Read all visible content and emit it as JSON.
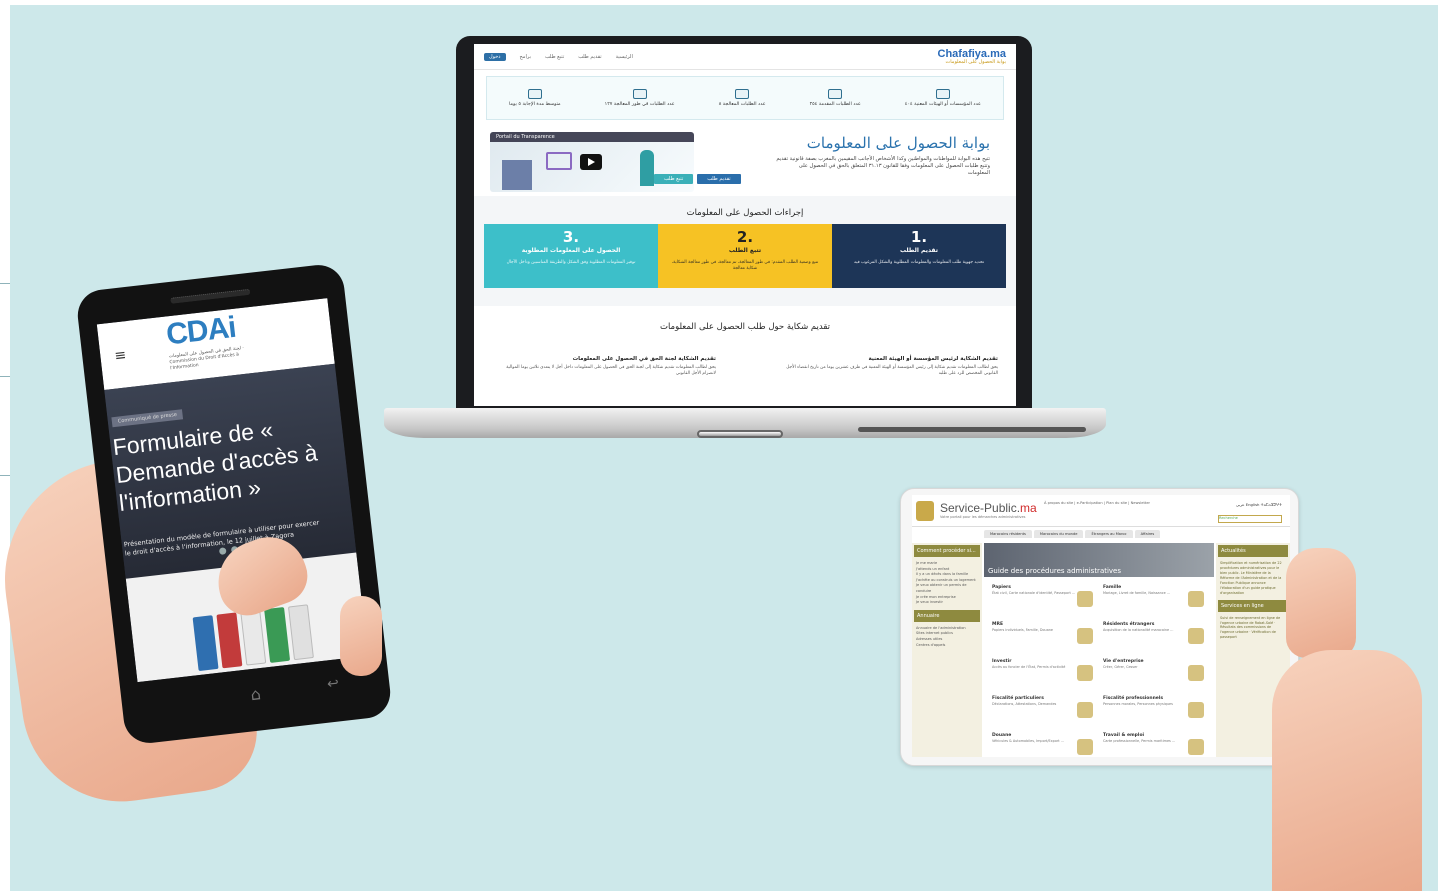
{
  "laptop": {
    "logo": "Chafafiya.ma",
    "logo_subtitle": "بوابة الحصول على المعلومات",
    "nav": [
      "الرئيسية",
      "تقديم طلب",
      "تتبع طلب",
      "برامج"
    ],
    "nav_button": "دخول",
    "stats": [
      "عدد المؤسسات أو الهيئات المعنية ٤٠٤",
      "عدد الطلبات المقدمة ٢٥٤",
      "عدد الطلبات المعالجة ٨",
      "عدد الطلبات في طور المعالجة ١٢٧",
      "متوسط مدة الإجابة ٥ يوما"
    ],
    "hero_title": "بوابة الحصول على المعلومات",
    "hero_desc": "تتيح هذه البوابة للمواطنات والمواطنين وكذا الأشخاص الأجانب المقيمين بالمغرب بصفة قانونية تقديم وتتبع طلبات الحصول على المعلومات وفقا للقانون ٣١.١٣ المتعلق بالحق في الحصول على المعلومات",
    "video_caption": "Portail du Transparence",
    "btn_submit": "تقديم طلب",
    "btn_track": "تتبع طلب",
    "procedures_title": "إجراءات الحصول على المعلومات",
    "steps": [
      {
        "num": ".1",
        "title": "تقديم الطلب",
        "desc": "تحديد جهوية طلب المعلومات والمعلومات المطلوبة والشكل المرغوب فيه",
        "color": "#1d3557"
      },
      {
        "num": ".2",
        "title": "تتبع الطلب",
        "desc": "تتبع وضعية الطلب المقدم: في طور المعالجة، تم معالجة، في طور معالجة الشكاية، شكاية معالجة",
        "color": "#f6c224"
      },
      {
        "num": ".3",
        "title": "الحصول على المعلومات المطلوبة",
        "desc": "توفير المعلومات المطلوبة وفق الشكل والطريقة المناسبين وداخل الآجال",
        "color": "#3dbfc9"
      }
    ],
    "complaint_title": "تقديم شكاية حول طلب الحصول على المعلومات",
    "complaint_cols": [
      {
        "title": "تقديم الشكاية لرئيس المؤسسة أو الهيئة المعنية",
        "desc": "يحق لطالب المعلومات تقديم شكاية إلى رئيس المؤسسة أو الهيئة المعنية في ظرف عشرين يوما من تاريخ انقضاء الأجل القانوني المخصص للرد على طلبه"
      },
      {
        "title": "تقديم الشكاية لجنة الحق في الحصول على المعلومات",
        "desc": "يحق لطالب المعلومات تقديم شكاية إلى لجنة الحق في الحصول على المعلومات داخل أجل لا يتعدى ثلاثين يوما الموالية لانصرام الأجل القانوني"
      }
    ]
  },
  "phone": {
    "logo": "CDAi",
    "logo_subtitle": "لجنة الحق في الحصول على المعلومات · Commission du Droit d'Accès à l'Information",
    "tag": "Communiqué de presse",
    "title": "Formulaire de « Demande d'accès à l'information »",
    "desc": "Présentation du modèle de formulaire à utiliser pour exercer le droit d'accès à l'information, le 12 juillet à Zagora"
  },
  "tablet": {
    "logo_a": "Service-Public.",
    "logo_b": "ma",
    "subtitle": "Votre portail pour les démarches administratives",
    "top_links": "À propos du site | e-Participation | Plan du site | Newsletter",
    "lang": "عربي English ⵜⴰⵎⴰⵣⵉⵖⵜ",
    "search": "Recherche",
    "tabs": [
      "Marocains résidents",
      "Marocains du monde",
      "Étrangers au Maroc",
      "Affaires"
    ],
    "left_box_title": "Comment procéder si...",
    "left_items": [
      "Je me marie",
      "J'attends un enfant",
      "Il y a un décès dans la famille",
      "J'achète ou construis un logement",
      "Je veux obtenir un permis de conduire",
      "Je crée mon entreprise",
      "Je veux investir"
    ],
    "annuaire": "Annuaire",
    "annuaire_items": [
      "Annuaire de l'administration",
      "Sites internet publics",
      "Adresses utiles",
      "Centres d'appels"
    ],
    "guide_title": "Guide des procédures administratives",
    "categories": [
      {
        "name": "Papiers",
        "desc": "État civil, Carte nationale d'identité, Passeport ..."
      },
      {
        "name": "Famille",
        "desc": "Mariage, Livret de famille, Naissance ..."
      },
      {
        "name": "MRE",
        "desc": "Papiers individuels, Famille, Douane"
      },
      {
        "name": "Résidents étrangers",
        "desc": "Acquisition de la nationalité marocaine ..."
      },
      {
        "name": "Investir",
        "desc": "Accès au foncier de l'État, Permis d'activité"
      },
      {
        "name": "Vie d'entreprise",
        "desc": "Créer, Gérer, Cesser"
      },
      {
        "name": "Fiscalité particuliers",
        "desc": "Déclarations, Attestations, Demandes"
      },
      {
        "name": "Fiscalité professionnels",
        "desc": "Personnes morales, Personnes physiques"
      },
      {
        "name": "Douane",
        "desc": "Véhicules & Automobiles, Import/Export ..."
      },
      {
        "name": "Travail & emploi",
        "desc": "Carte professionnelle, Permis maritimes ..."
      }
    ],
    "actualites": "Actualités",
    "actualites_text": "Simplification et numérisation de 22 procédures administratives pour le bien public. Le Ministère de la Réforme de l'Administration et de la Fonction Publique annonce l'élaboration d'un guide pratique d'organisation",
    "services_title": "Services en ligne",
    "services_text": "Suivi de renseignement en ligne de l'agence urbaine de Rabat-Salé · Résultats des commissions de l'agence urbaine · Vérification de passeport"
  }
}
